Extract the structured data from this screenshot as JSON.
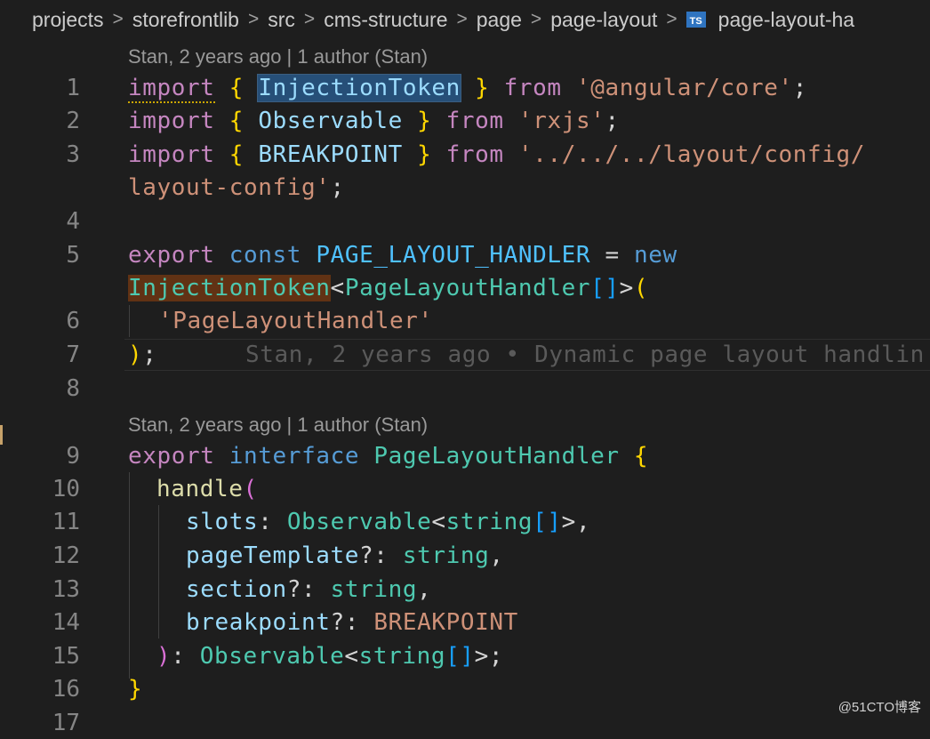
{
  "breadcrumb": {
    "items": [
      "projects",
      "storefrontlib",
      "src",
      "cms-structure",
      "page",
      "page-layout"
    ],
    "file_icon": "TS",
    "file_name": "page-layout-ha"
  },
  "codelens": {
    "top": "Stan, 2 years ago | 1 author (Stan)",
    "interface": "Stan, 2 years ago | 1 author (Stan)"
  },
  "line_numbers": [
    "1",
    "2",
    "3",
    "4",
    "5",
    "6",
    "7",
    "8",
    "9",
    "10",
    "11",
    "12",
    "13",
    "14",
    "15",
    "16",
    "17"
  ],
  "blame_inline": "Stan, 2 years ago • Dynamic page layout handlin",
  "watermark": "@51CTO博客",
  "tokens": {
    "import": "import",
    "lbrace": "{",
    "rbrace": "}",
    "from": "from",
    "semi": ";",
    "InjectionToken": "InjectionToken",
    "angular_core": "'@angular/core'",
    "Observable": "Observable",
    "rxjs": "'rxjs'",
    "BREAKPOINT": "BREAKPOINT",
    "layout_path_a": "'../../../layout/config/",
    "layout_path_b": "layout-config'",
    "export": "export",
    "const": "const",
    "PAGE_LAYOUT_HANDLER": "PAGE_LAYOUT_HANDLER",
    "eq": "=",
    "new": "new",
    "lt": "<",
    "gt": ">",
    "PageLayoutHandler": "PageLayoutHandler",
    "brackets": "[]",
    "lparen": "(",
    "rparen": ")",
    "str_PageLayoutHandler": "'PageLayoutHandler'",
    "interface": "interface",
    "handle": "handle",
    "slots": "slots",
    "colon": ":",
    "comma": ",",
    "string": "string",
    "pageTemplate": "pageTemplate",
    "qcolon": "?:",
    "section": "section",
    "breakpoint": "breakpoint"
  }
}
